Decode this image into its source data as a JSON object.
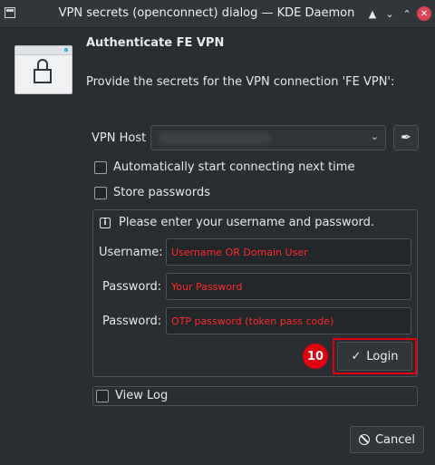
{
  "window": {
    "title": "VPN secrets (openconnect) dialog — KDE Daemon",
    "controls": [
      "keep-above",
      "minimize",
      "maximize",
      "close"
    ]
  },
  "header": {
    "title": "Authenticate FE VPN",
    "description": "Provide the secrets for the VPN connection 'FE VPN':"
  },
  "vpn_host": {
    "label": "VPN Host",
    "value": ""
  },
  "options": {
    "auto_connect_label": "Automatically start connecting next time",
    "auto_connect_checked": false,
    "store_passwords_label": "Store passwords",
    "store_passwords_checked": false
  },
  "auth_panel": {
    "message": "Please enter your username and password.",
    "username_label": "Username:",
    "username_value": "Username OR Domain User",
    "password_label": "Password:",
    "password_value": "Your Password",
    "otp_label": "Password:",
    "otp_value": "OTP password (token pass code)"
  },
  "annotation": {
    "step_number": "10",
    "color": "#e3000e"
  },
  "buttons": {
    "login_label": "Login",
    "view_log_label": "View Log",
    "cancel_label": "Cancel"
  },
  "icons": {
    "app": "window-icon",
    "lock": "lock-window-icon",
    "edit": "pen-icon",
    "info": "info-icon",
    "check": "checkmark-icon",
    "cancel": "cancel-icon"
  }
}
